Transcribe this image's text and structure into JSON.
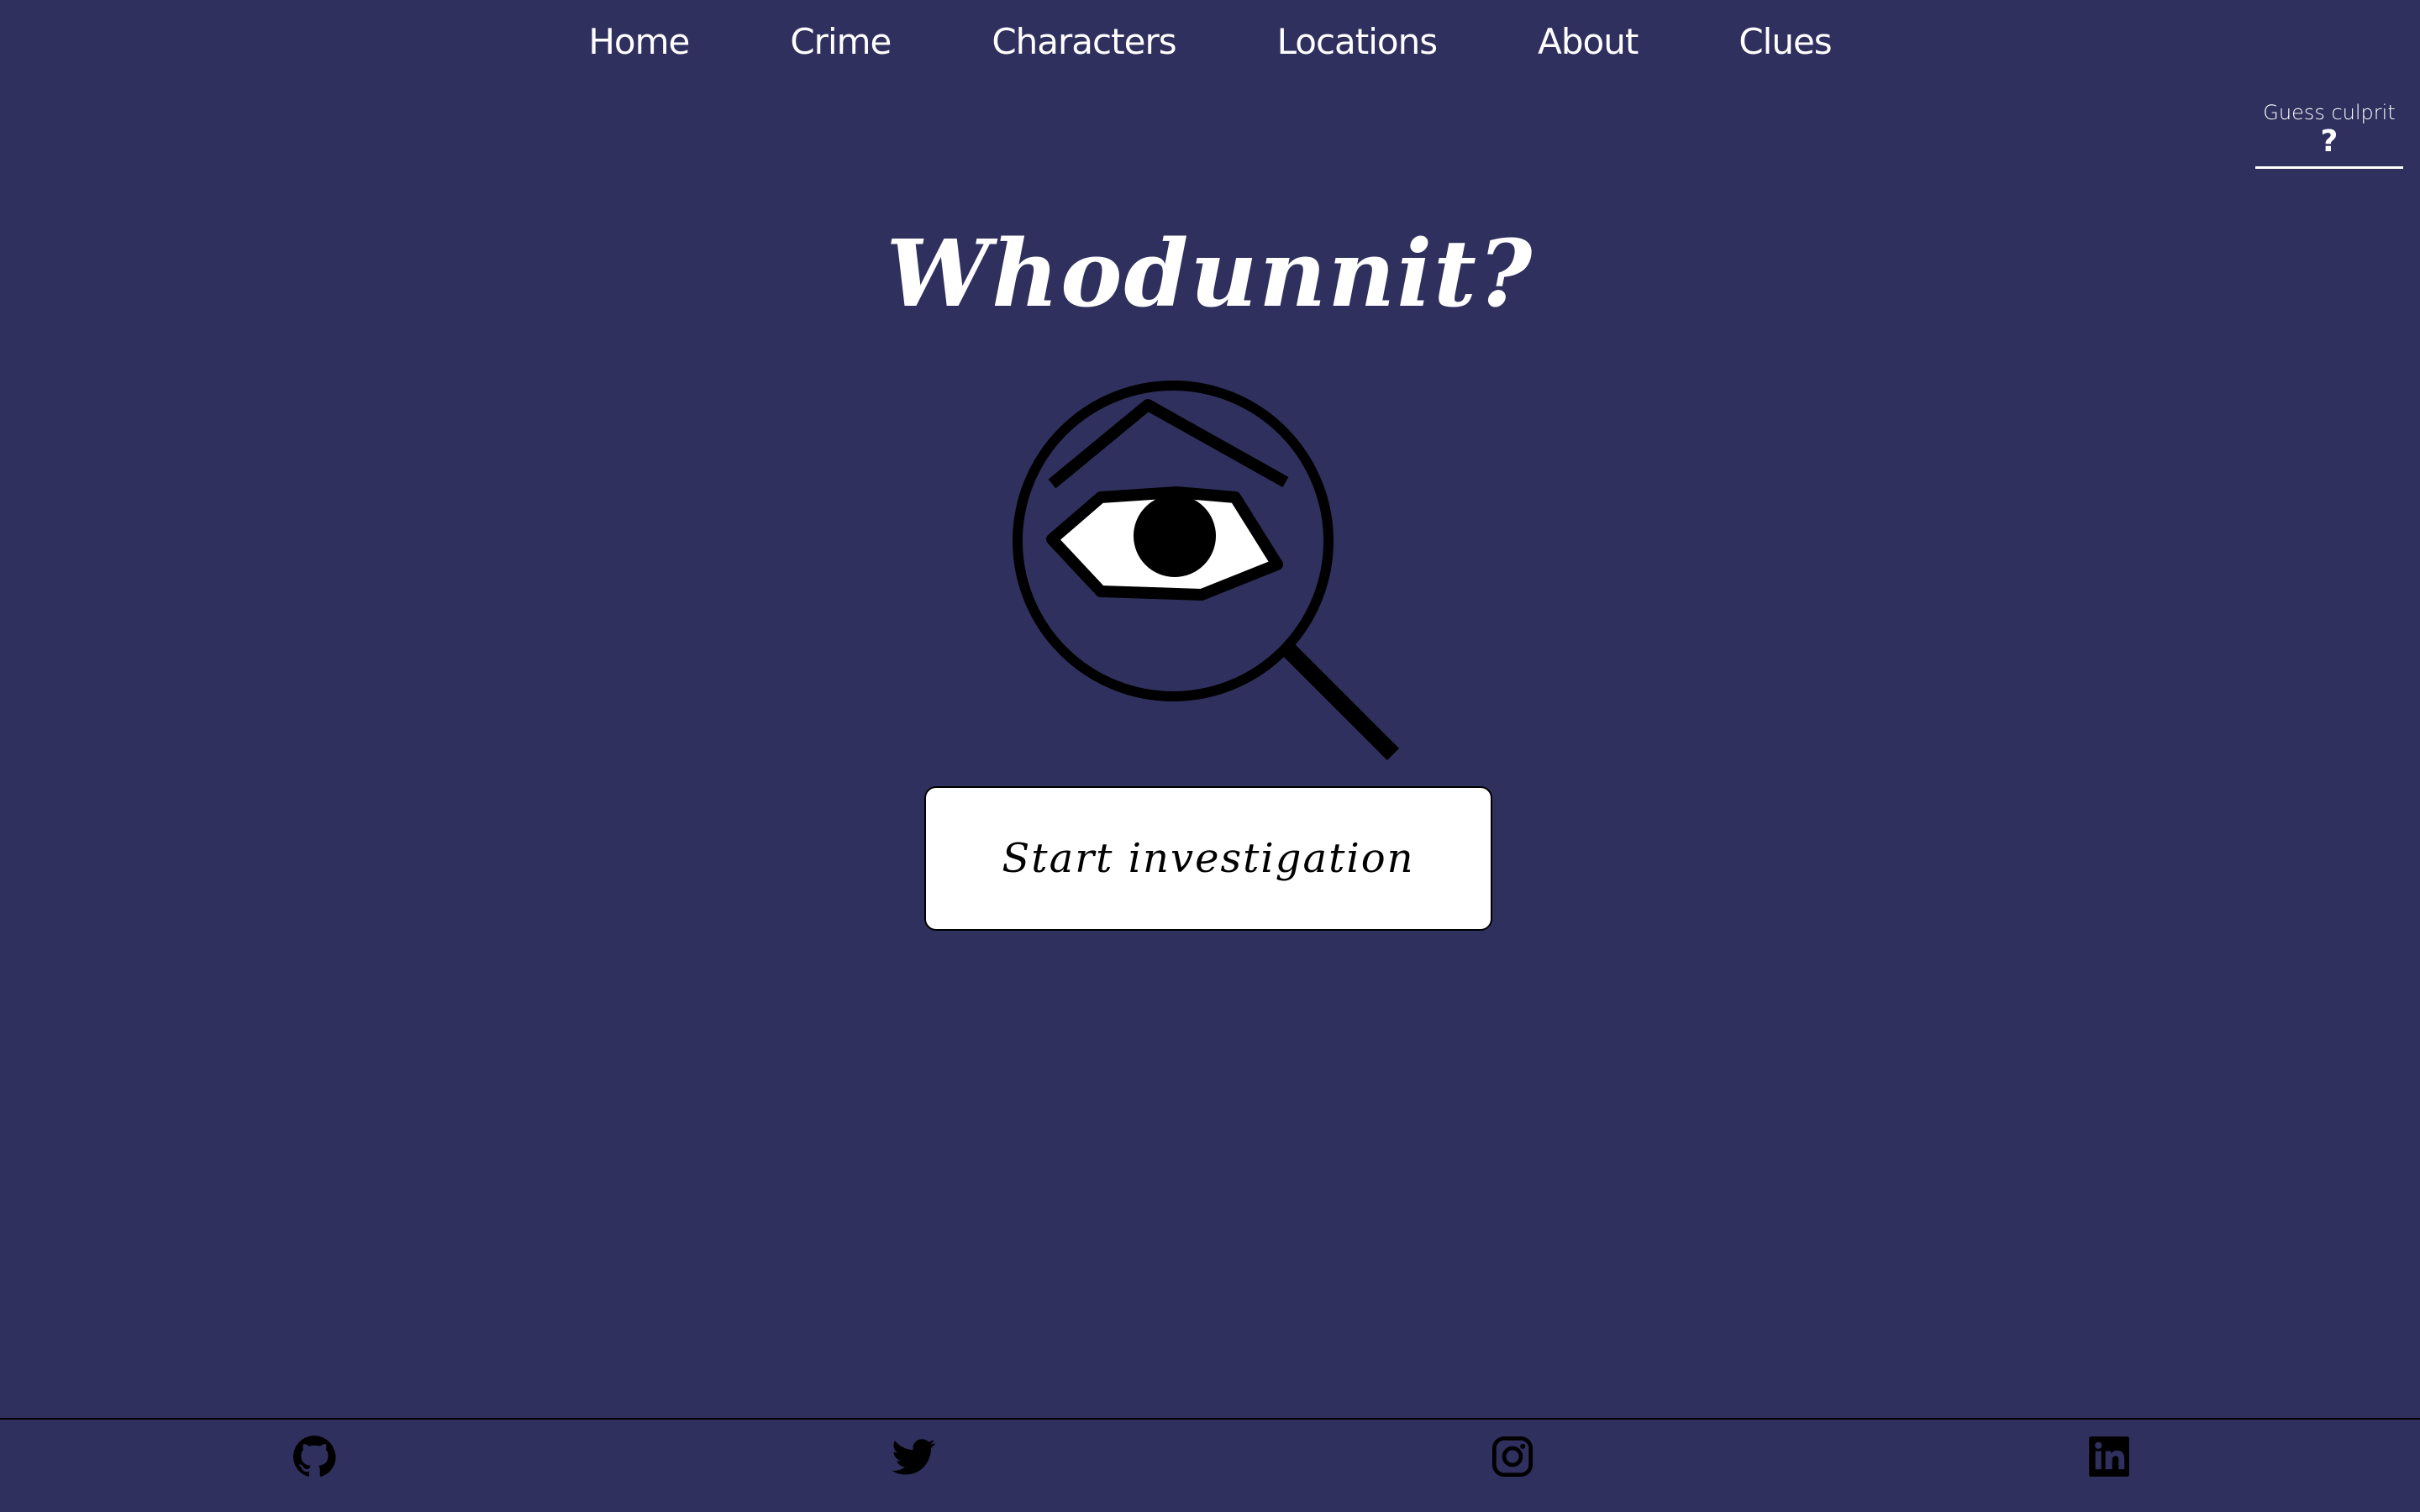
{
  "nav": {
    "items": [
      {
        "label": "Home"
      },
      {
        "label": "Crime"
      },
      {
        "label": "Characters"
      },
      {
        "label": "Locations"
      },
      {
        "label": "About"
      },
      {
        "label": "Clues"
      }
    ]
  },
  "guess": {
    "label": "Guess culprit",
    "value": "?"
  },
  "hero": {
    "title": "Whodunnit?",
    "logo_icon": "magnifying-glass-eye-icon",
    "start_label": "Start investigation"
  },
  "footer": {
    "links": [
      {
        "icon": "github-icon"
      },
      {
        "icon": "twitter-icon"
      },
      {
        "icon": "instagram-icon"
      },
      {
        "icon": "linkedin-icon"
      }
    ]
  },
  "colors": {
    "background": "#30305e",
    "text": "#ffffff",
    "button_bg": "#ffffff",
    "icon": "#000000"
  }
}
